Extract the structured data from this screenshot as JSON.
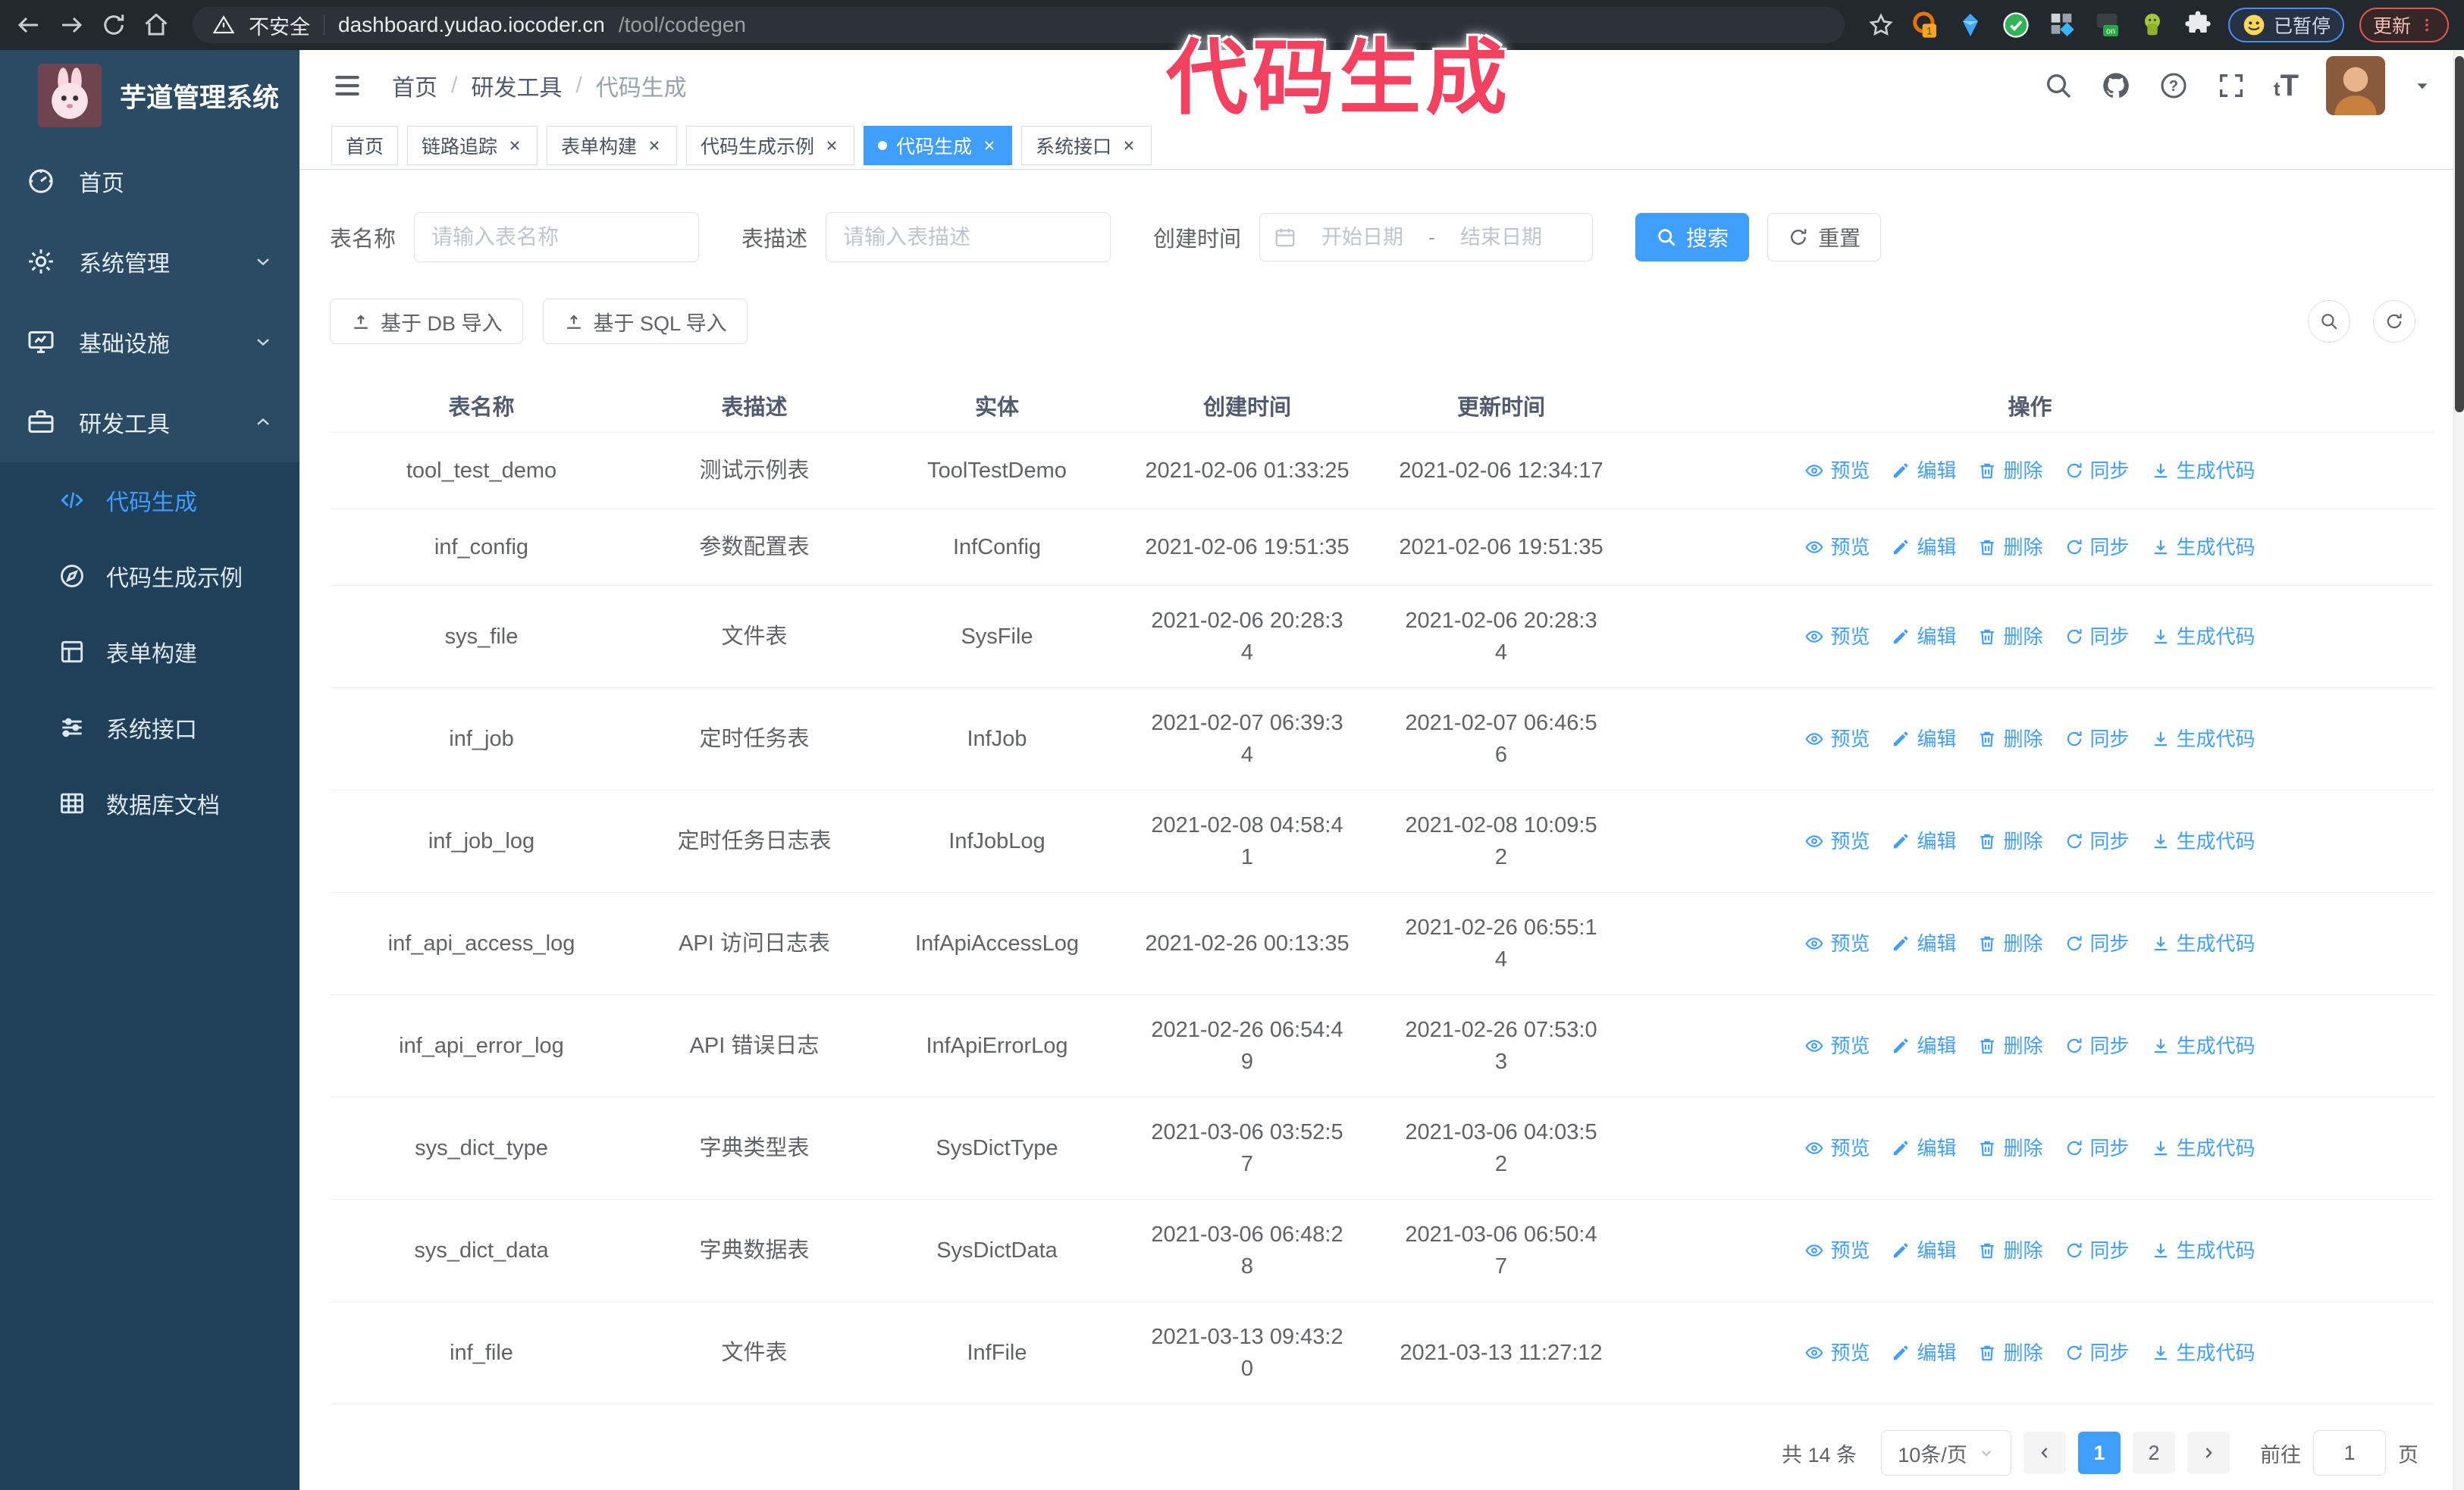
{
  "colors": {
    "accent": "#409eff",
    "annotation_pink": "#f4415f",
    "chrome_bg": "#23272e",
    "sidebar_bg": "#2b4a63",
    "sidebar_sub_bg": "#1f4058"
  },
  "annotation": {
    "text": "代码生成"
  },
  "browser": {
    "security_label": "不安全",
    "url_host": "dashboard.yudao.iocoder.cn",
    "url_path": "/tool/codegen",
    "paused_label": "已暂停",
    "update_label": "更新"
  },
  "sidebar": {
    "app_title": "芋道管理系统",
    "items": [
      {
        "key": "home",
        "label": "首页",
        "icon": "dashboard-icon"
      },
      {
        "key": "system-mgmt",
        "label": "系统管理",
        "icon": "gear-icon",
        "chevron": "down"
      },
      {
        "key": "infrastructure",
        "label": "基础设施",
        "icon": "monitor-icon",
        "chevron": "down"
      },
      {
        "key": "dev-tools",
        "label": "研发工具",
        "icon": "briefcase-icon",
        "chevron": "up"
      }
    ],
    "sub_items": [
      {
        "key": "codegen",
        "label": "代码生成",
        "icon": "code-icon",
        "active": true
      },
      {
        "key": "codegen-demo",
        "label": "代码生成示例",
        "icon": "compass-icon"
      },
      {
        "key": "form-builder",
        "label": "表单构建",
        "icon": "form-icon"
      },
      {
        "key": "system-api",
        "label": "系统接口",
        "icon": "sliders-icon"
      },
      {
        "key": "db-doc",
        "label": "数据库文档",
        "icon": "db-table-icon"
      }
    ]
  },
  "header": {
    "breadcrumb": [
      "首页",
      "研发工具",
      "代码生成"
    ]
  },
  "tabs": [
    {
      "label": "首页",
      "closable": false,
      "active": false
    },
    {
      "label": "链路追踪",
      "closable": true,
      "active": false
    },
    {
      "label": "表单构建",
      "closable": true,
      "active": false
    },
    {
      "label": "代码生成示例",
      "closable": true,
      "active": false
    },
    {
      "label": "代码生成",
      "closable": true,
      "active": true
    },
    {
      "label": "系统接口",
      "closable": true,
      "active": false
    }
  ],
  "filters": {
    "name_label": "表名称",
    "name_placeholder": "请输入表名称",
    "desc_label": "表描述",
    "desc_placeholder": "请输入表描述",
    "time_label": "创建时间",
    "start_placeholder": "开始日期",
    "range_separator": "-",
    "end_placeholder": "结束日期",
    "search_label": "搜索",
    "reset_label": "重置"
  },
  "toolbar": {
    "db_import_label": "基于 DB 导入",
    "sql_import_label": "基于 SQL 导入"
  },
  "table": {
    "columns": [
      "表名称",
      "表描述",
      "实体",
      "创建时间",
      "更新时间",
      "操作"
    ],
    "actions": [
      {
        "key": "preview",
        "label": "预览",
        "icon": "eye-icon"
      },
      {
        "key": "edit",
        "label": "编辑",
        "icon": "pencil-icon"
      },
      {
        "key": "delete",
        "label": "删除",
        "icon": "trash-icon"
      },
      {
        "key": "sync",
        "label": "同步",
        "icon": "sync-icon"
      },
      {
        "key": "generate",
        "label": "生成代码",
        "icon": "download-icon"
      }
    ],
    "rows": [
      {
        "name": "tool_test_demo",
        "desc": "测试示例表",
        "entity": "ToolTestDemo",
        "created": "2021-02-06 01:33:25",
        "updated": "2021-02-06 12:34:17"
      },
      {
        "name": "inf_config",
        "desc": "参数配置表",
        "entity": "InfConfig",
        "created": "2021-02-06 19:51:35",
        "updated": "2021-02-06 19:51:35"
      },
      {
        "name": "sys_file",
        "desc": "文件表",
        "entity": "SysFile",
        "created": "2021-02-06 20:28:3\n4",
        "updated": "2021-02-06 20:28:3\n4"
      },
      {
        "name": "inf_job",
        "desc": "定时任务表",
        "entity": "InfJob",
        "created": "2021-02-07 06:39:3\n4",
        "updated": "2021-02-07 06:46:5\n6"
      },
      {
        "name": "inf_job_log",
        "desc": "定时任务日志表",
        "entity": "InfJobLog",
        "created": "2021-02-08 04:58:4\n1",
        "updated": "2021-02-08 10:09:5\n2"
      },
      {
        "name": "inf_api_access_log",
        "desc": "API 访问日志表",
        "entity": "InfApiAccessLog",
        "created": "2021-02-26 00:13:35",
        "updated": "2021-02-26 06:55:1\n4"
      },
      {
        "name": "inf_api_error_log",
        "desc": "API 错误日志",
        "entity": "InfApiErrorLog",
        "created": "2021-02-26 06:54:4\n9",
        "updated": "2021-02-26 07:53:0\n3"
      },
      {
        "name": "sys_dict_type",
        "desc": "字典类型表",
        "entity": "SysDictType",
        "created": "2021-03-06 03:52:5\n7",
        "updated": "2021-03-06 04:03:5\n2"
      },
      {
        "name": "sys_dict_data",
        "desc": "字典数据表",
        "entity": "SysDictData",
        "created": "2021-03-06 06:48:2\n8",
        "updated": "2021-03-06 06:50:4\n7"
      },
      {
        "name": "inf_file",
        "desc": "文件表",
        "entity": "InfFile",
        "created": "2021-03-13 09:43:2\n0",
        "updated": "2021-03-13 11:27:12"
      }
    ]
  },
  "pagination": {
    "total_label": "共 14 条",
    "page_size_label": "10条/页",
    "pages": [
      "1",
      "2"
    ],
    "active_page": "1",
    "goto_label": "前往",
    "goto_value": "1",
    "page_unit_label": "页"
  }
}
